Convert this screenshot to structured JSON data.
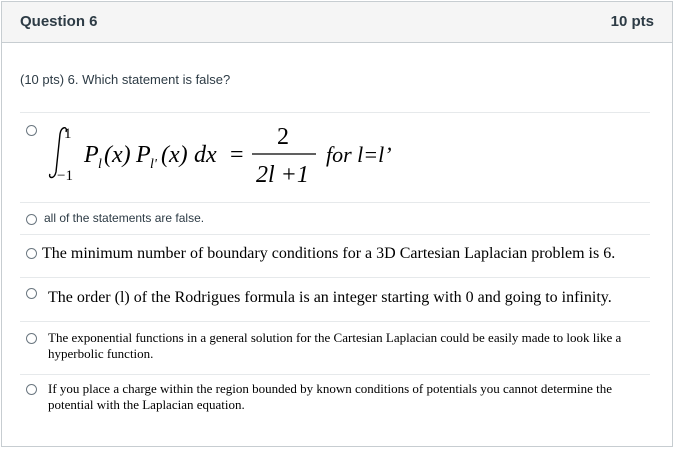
{
  "question": {
    "title": "Question 6",
    "points": "10 pts",
    "prompt": "(10 pts) 6. Which statement is false?"
  },
  "answers": [
    {
      "id": "a1",
      "type": "equation",
      "integral_upper": "1",
      "integral_lower": "−1",
      "integrand": "P",
      "sub_l": "l",
      "sub_lprime": "l'",
      "arg_x": "(x)",
      "dx": "dx",
      "equals": "=",
      "numerator": "2",
      "denominator": "2l +1",
      "condition": "for l=l’"
    },
    {
      "id": "a2",
      "text": "all of the statements are false."
    },
    {
      "id": "a3",
      "text": "The minimum number of boundary conditions for a 3D Cartesian Laplacian problem is 6."
    },
    {
      "id": "a4",
      "text": "The order (l) of the Rodrigues formula is an integer starting with 0 and going to infinity."
    },
    {
      "id": "a5",
      "text": "The exponential functions in a general solution for the Cartesian Laplacian could be easily made to look like a hyperbolic function."
    },
    {
      "id": "a6",
      "text": "If you place a charge within the region bounded by known conditions of potentials you cannot determine the potential with the Laplacian equation."
    }
  ]
}
